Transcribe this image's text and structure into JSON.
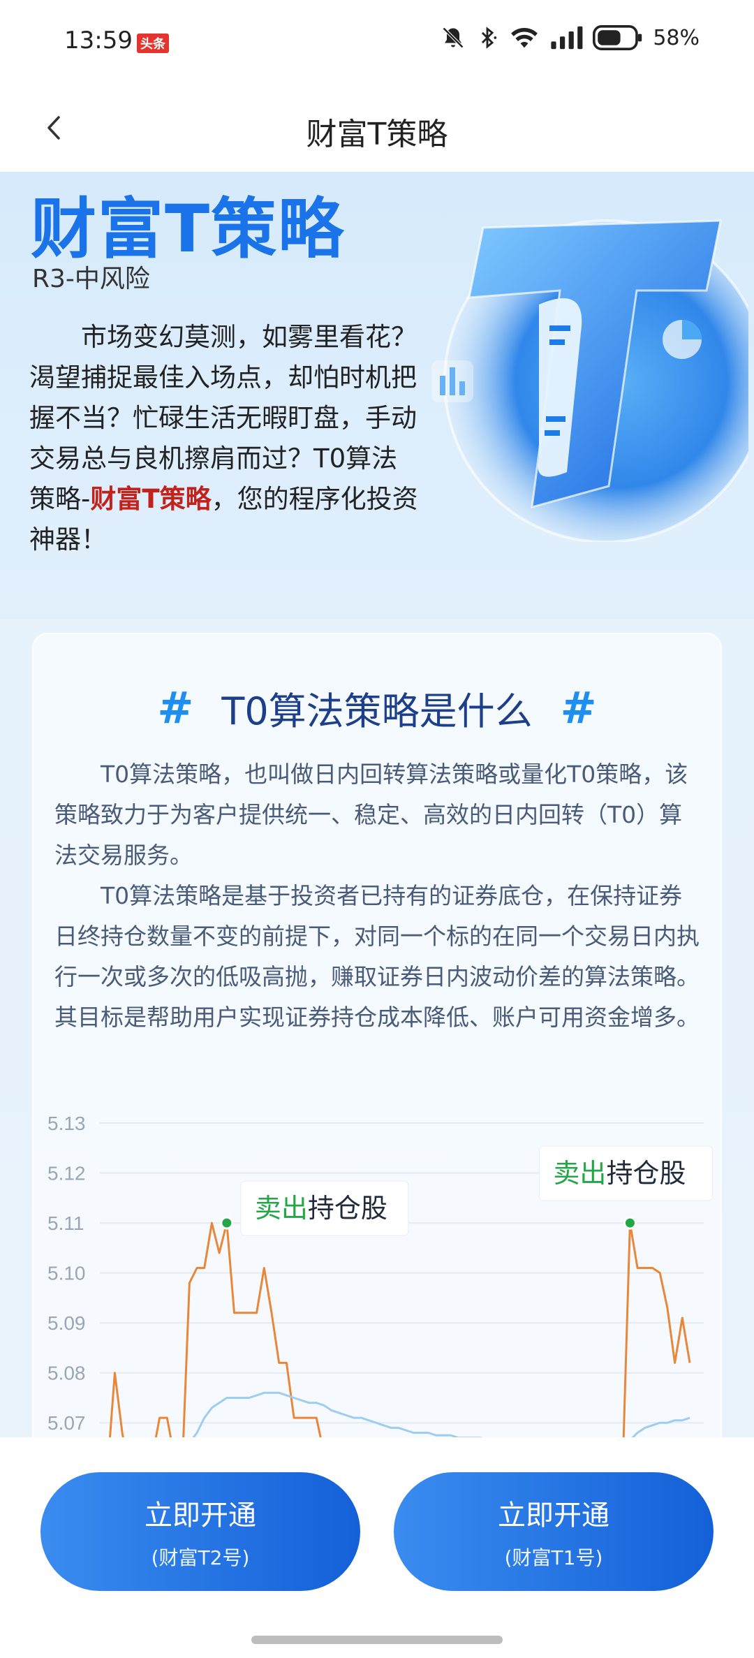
{
  "status_bar": {
    "time": "13:59",
    "badge": "头条",
    "battery": "58%",
    "icons": [
      "bell-muted-icon",
      "bluetooth-icon",
      "wifi-icon",
      "signal-icon",
      "battery-icon"
    ]
  },
  "nav": {
    "title": "财富T策略",
    "back_icon": "chevron-left-icon"
  },
  "hero": {
    "title": "财富T策略",
    "risk": "R3-中风险",
    "desc_before": "市场变幻莫测，如雾里看花？渴望捕捉最佳入场点，却怕时机把握不当？忙碌生活无暇盯盘，手动交易总与良机擦肩而过？T0算法策略-",
    "desc_highlight": "财富T策略",
    "desc_after": "，您的程序化投资神器！"
  },
  "section": {
    "title": "T0算法策略是什么",
    "para1": "T0算法策略，也叫做日内回转算法策略或量化T0策略，该策略致力于为客户提供统一、稳定、高效的日内回转（T0）算法交易服务。",
    "para2": "T0算法策略是基于投资者已持有的证券底仓，在保持证券日终持仓数量不变的前提下，对同一个标的在同一个交易日内执行一次或多次的低吸高抛，赚取证券日内波动价差的算法策略。其目标是帮助用户实现证券持仓成本降低、账户可用资金增多。"
  },
  "chart_data": {
    "type": "line",
    "yticks": [
      "5.13",
      "5.12",
      "5.11",
      "5.10",
      "5.09",
      "5.08",
      "5.07"
    ],
    "ylim": [
      5.065,
      5.13
    ],
    "grid": true,
    "annotations": [
      {
        "text_green": "卖出",
        "text_dark": "持仓股"
      },
      {
        "text_green": "卖出",
        "text_dark": "持仓股"
      }
    ],
    "series": [
      {
        "color": "#e8873a",
        "values": [
          5.06,
          5.06,
          5.08,
          5.068,
          5.06,
          5.058,
          5.06,
          5.063,
          5.071,
          5.071,
          5.063,
          5.06,
          5.098,
          5.101,
          5.101,
          5.11,
          5.104,
          5.11,
          5.092,
          5.092,
          5.092,
          5.092,
          5.101,
          5.092,
          5.082,
          5.082,
          5.071,
          5.071,
          5.071,
          5.071,
          5.064,
          5.06,
          5.06,
          5.06,
          5.06,
          5.06,
          5.06,
          5.06,
          5.06,
          5.06,
          5.06,
          5.06,
          5.06,
          5.06,
          5.06,
          5.06,
          5.06,
          5.06,
          5.06,
          5.06,
          5.06,
          5.06,
          5.06,
          5.06,
          5.06,
          5.06,
          5.06,
          5.06,
          5.06,
          5.06,
          5.06,
          5.06,
          5.06,
          5.06,
          5.06,
          5.06,
          5.06,
          5.06,
          5.06,
          5.06,
          5.06,
          5.11,
          5.101,
          5.101,
          5.101,
          5.1,
          5.093,
          5.082,
          5.091,
          5.082
        ]
      },
      {
        "color": "#9ecdf0",
        "values": [
          5.06,
          5.06,
          5.06,
          5.06,
          5.06,
          5.06,
          5.06,
          5.06,
          5.06,
          5.06,
          5.06,
          5.06,
          5.066,
          5.068,
          5.071,
          5.073,
          5.074,
          5.075,
          5.075,
          5.075,
          5.075,
          5.0755,
          5.076,
          5.076,
          5.076,
          5.0755,
          5.075,
          5.0745,
          5.074,
          5.074,
          5.0735,
          5.0725,
          5.072,
          5.0715,
          5.071,
          5.071,
          5.0705,
          5.07,
          5.0695,
          5.069,
          5.069,
          5.0685,
          5.068,
          5.068,
          5.068,
          5.0675,
          5.0675,
          5.0675,
          5.067,
          5.067,
          5.067,
          5.067,
          5.0665,
          5.0665,
          5.066,
          5.066,
          5.066,
          5.066,
          5.066,
          5.066,
          5.066,
          5.066,
          5.066,
          5.066,
          5.066,
          5.066,
          5.066,
          5.066,
          5.066,
          5.066,
          5.066,
          5.0665,
          5.068,
          5.069,
          5.0695,
          5.07,
          5.07,
          5.0705,
          5.0705,
          5.071
        ]
      }
    ],
    "markers": [
      17,
      71
    ]
  },
  "buttons": [
    {
      "line1": "立即开通",
      "line2": "(财富T2号)"
    },
    {
      "line1": "立即开通",
      "line2": "(财富T1号)"
    }
  ]
}
